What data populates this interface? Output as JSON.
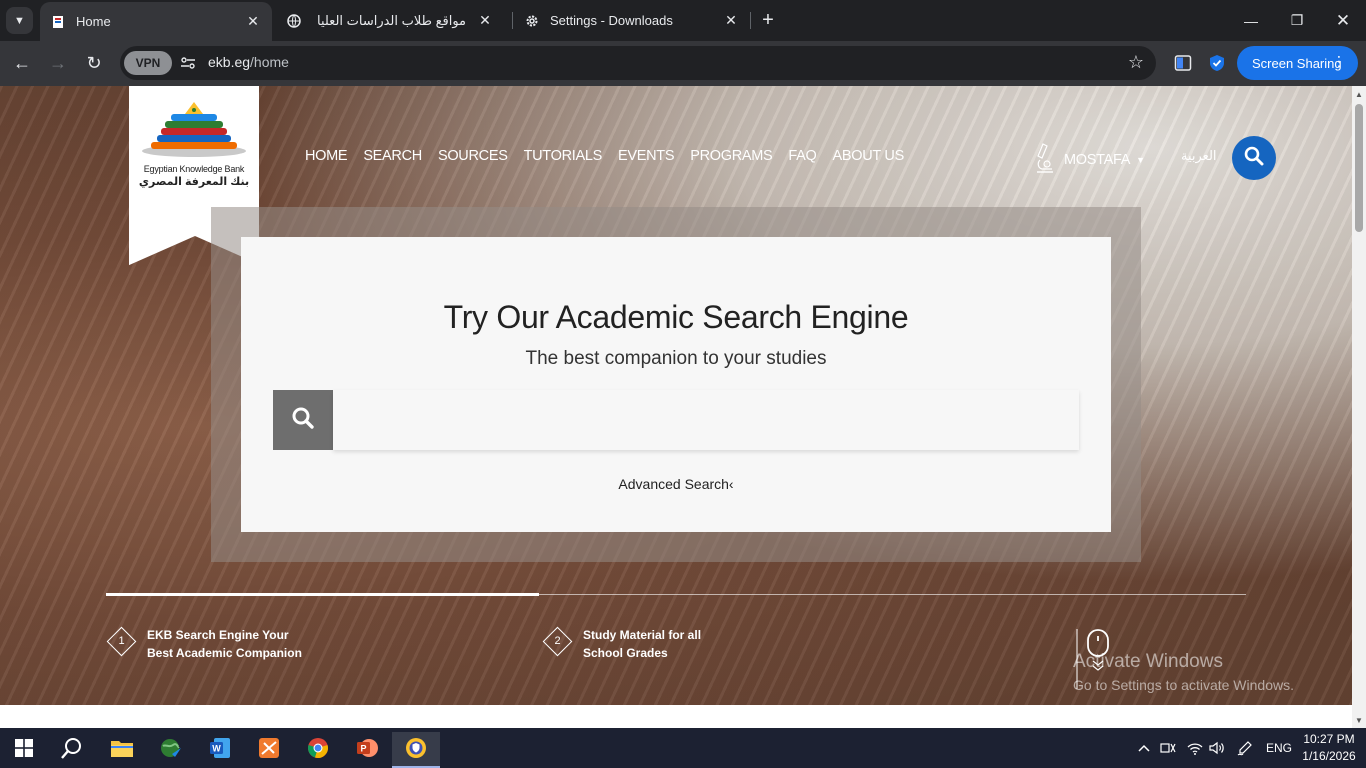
{
  "browser": {
    "tabs": [
      {
        "title": "Home",
        "active": true
      },
      {
        "title": "مواقع طلاب الدراسات العليا",
        "active": false
      },
      {
        "title": "Settings - Downloads",
        "active": false
      }
    ],
    "new_tab_glyph": "+",
    "vpn_label": "VPN",
    "url_host": "ekb.eg",
    "url_path": "/home",
    "screen_sharing_label": "Screen Sharing"
  },
  "site": {
    "logo_en": "Egyptian Knowledge Bank",
    "logo_ar": "بنك المعرفة المصري",
    "nav": [
      "HOME",
      "SEARCH",
      "SOURCES",
      "TUTORIALS",
      "EVENTS",
      "PROGRAMS",
      "FAQ",
      "ABOUT US"
    ],
    "user_name": "MOSTAFA",
    "language_link": "العربية",
    "search_card": {
      "title": "Try Our Academic Search Engine",
      "subtitle": "The best companion to your studies",
      "input_placeholder": "",
      "advanced_search": "Advanced Search‹"
    },
    "slider": {
      "progress": 0.38,
      "items": [
        {
          "num": "1",
          "label": "EKB Search Engine Your Best Academic Companion"
        },
        {
          "num": "2",
          "label": "Study Material for all School Grades"
        }
      ]
    }
  },
  "watermark": {
    "line1": "Activate Windows",
    "line2": "Go to Settings to activate Windows."
  },
  "taskbar": {
    "language": "ENG",
    "time": "10:27 PM",
    "date": "1/16/2026"
  },
  "colors": {
    "accent_blue": "#1a73e8",
    "site_search_blue": "#1565c0",
    "taskbar": "#1c2132",
    "chrome_dark": "#202124"
  }
}
